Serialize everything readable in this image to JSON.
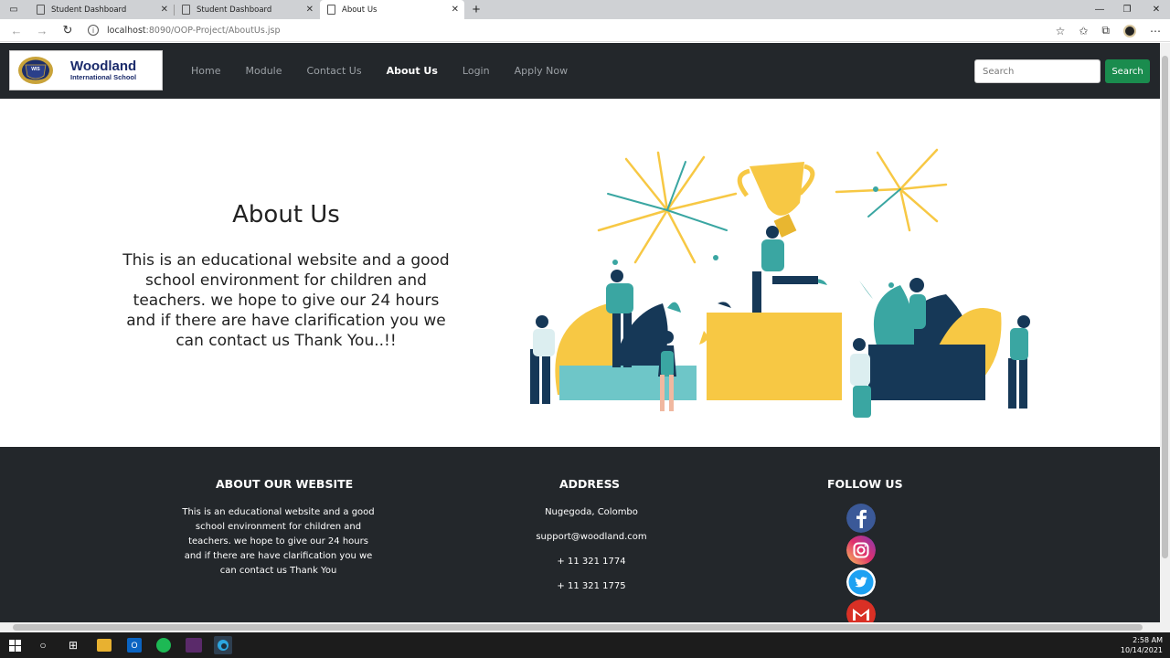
{
  "browser": {
    "tabs": [
      {
        "label": "Student Dashboard",
        "active": false
      },
      {
        "label": "Student Dashboard",
        "active": false
      },
      {
        "label": "About Us",
        "active": true
      }
    ],
    "url_host": "localhost",
    "url_rest": ":8090/OOP-Project/AboutUs.jsp"
  },
  "site": {
    "logo": {
      "title": "Woodland",
      "subtitle": "International School",
      "crest_text": "WIS"
    },
    "nav": [
      {
        "label": "Home",
        "active": false
      },
      {
        "label": "Module",
        "active": false
      },
      {
        "label": "Contact Us",
        "active": false
      },
      {
        "label": "About Us",
        "active": true
      },
      {
        "label": "Login",
        "active": false
      },
      {
        "label": "Apply Now",
        "active": false
      }
    ],
    "search": {
      "placeholder": "Search",
      "button": "Search"
    }
  },
  "hero": {
    "title": "About Us",
    "text": "This is an educational website and a good school environment for children and teachers. we hope to give our 24 hours and if there are have clarification you we can contact us Thank You..!!"
  },
  "footer": {
    "about": {
      "heading": "ABOUT OUR WEBSITE",
      "text": "This is an educational website and a good school environment for children and teachers. we hope to give our 24 hours and if there are have clarification you we can contact us Thank You"
    },
    "address": {
      "heading": "ADDRESS",
      "location": "Nugegoda, Colombo",
      "email": "support@woodland.com",
      "phone1": "+ 11 321 1774",
      "phone2": "+ 11 321 1775"
    },
    "follow": {
      "heading": "FOLLOW US",
      "icons": [
        "facebook-icon",
        "instagram-icon",
        "twitter-icon",
        "gmail-icon"
      ]
    }
  },
  "taskbar": {
    "time": "2:58 AM",
    "date": "10/14/2021"
  },
  "colors": {
    "navbar": "#23272b",
    "search_button": "#1a8c4e",
    "footer": "#23272b",
    "accent_yellow": "#f7c844",
    "accent_teal": "#3aa6a2",
    "navy": "#163857"
  }
}
